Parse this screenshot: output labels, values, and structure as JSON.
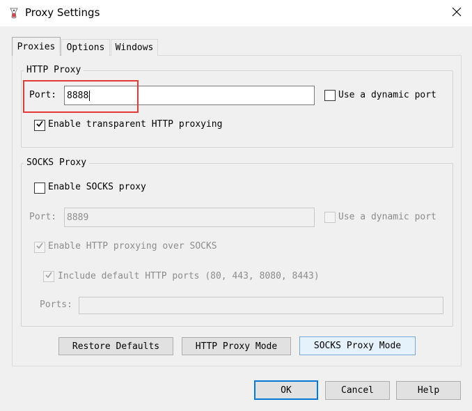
{
  "window": {
    "title": "Proxy Settings",
    "icon": "fiddler-app-icon",
    "close_icon": "close-icon"
  },
  "tabs": [
    {
      "label": "Proxies",
      "active": true
    },
    {
      "label": "Options",
      "active": false
    },
    {
      "label": "Windows",
      "active": false
    }
  ],
  "http_proxy": {
    "group_label": "HTTP Proxy",
    "port_label": "Port:",
    "port_value": "8888",
    "dynamic_port_label": "Use a dynamic port",
    "dynamic_port_checked": false,
    "transparent_label": "Enable transparent HTTP proxying",
    "transparent_checked": true
  },
  "socks_proxy": {
    "group_label": "SOCKS Proxy",
    "enable_label": "Enable SOCKS proxy",
    "enable_checked": false,
    "port_label": "Port:",
    "port_value": "8889",
    "dynamic_port_label": "Use a dynamic port",
    "dynamic_port_checked": false,
    "http_over_socks_label": "Enable HTTP proxying over SOCKS",
    "http_over_socks_checked": true,
    "include_default_ports_label": "Include default HTTP ports (80, 443, 8080, 8443)",
    "include_default_ports_checked": true,
    "ports_label": "Ports:",
    "ports_value": ""
  },
  "mode_buttons": {
    "restore_defaults": "Restore Defaults",
    "http_proxy_mode": "HTTP Proxy Mode",
    "socks_proxy_mode": "SOCKS Proxy Mode"
  },
  "dialog_buttons": {
    "ok": "OK",
    "cancel": "Cancel",
    "help": "Help"
  },
  "colors": {
    "highlight": "#e53935",
    "focus_border": "#0078d7",
    "selected_button_bg": "#e5f1fb"
  }
}
